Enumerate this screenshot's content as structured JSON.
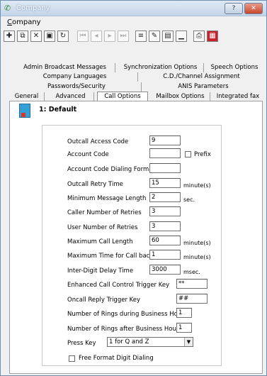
{
  "window": {
    "title": "Company",
    "help_label": "?",
    "close_label": "✕"
  },
  "menu": {
    "company": "Company"
  },
  "toolbar": {
    "buttons": [
      {
        "name": "add-icon",
        "glyph": "✚"
      },
      {
        "name": "copy-icon",
        "glyph": "⧉"
      },
      {
        "name": "delete-icon",
        "glyph": "✕"
      },
      {
        "name": "save-icon",
        "glyph": "▣"
      },
      {
        "name": "refresh-icon",
        "glyph": "↻"
      },
      {
        "name": "first-record-icon",
        "glyph": "⏮"
      },
      {
        "name": "previous-record-icon",
        "glyph": "◂"
      },
      {
        "name": "next-record-icon",
        "glyph": "▸"
      },
      {
        "name": "last-record-icon",
        "glyph": "⏭"
      },
      {
        "name": "list-icon",
        "glyph": "≡"
      },
      {
        "name": "edit-icon",
        "glyph": "✎"
      },
      {
        "name": "properties-icon",
        "glyph": "▤"
      },
      {
        "name": "chart-icon",
        "glyph": "▁"
      },
      {
        "name": "print-icon",
        "glyph": "⎙"
      },
      {
        "name": "report-icon",
        "glyph": "▦"
      }
    ]
  },
  "tabs": {
    "row1": [
      "Admin Broadcast Messages",
      "Synchronization Options",
      "Speech Options"
    ],
    "row2": [
      "Company Languages",
      "C.D./Channel Assignment"
    ],
    "row3": [
      "Passwords/Security",
      "ANIS Parameters"
    ],
    "row4": [
      "General",
      "Advanced",
      "Call Options",
      "Mailbox Options",
      "Integrated fax"
    ]
  },
  "header": {
    "text": "1: Default"
  },
  "form": {
    "outcall_access_code": {
      "label": "Outcall Access Code",
      "value": "9"
    },
    "account_code": {
      "label": "Account Code",
      "value": "",
      "prefix_label": "Prefix"
    },
    "account_code_dialing_format": {
      "label": "Account Code Dialing Format",
      "value": ""
    },
    "outcall_retry_time": {
      "label": "Outcall Retry Time",
      "value": "15",
      "unit": "minute(s)"
    },
    "minimum_message_length": {
      "label": "Minimum Message Length",
      "value": "2",
      "unit": "sec."
    },
    "caller_number_of_retries": {
      "label": "Caller Number of Retries",
      "value": "3"
    },
    "user_number_of_retries": {
      "label": "User Number of Retries",
      "value": "3"
    },
    "maximum_call_length": {
      "label": "Maximum Call Length",
      "value": "60",
      "unit": "minute(s)"
    },
    "maximum_time_for_call_back": {
      "label": "Maximum Time for Call back",
      "value": "1",
      "unit": "minute(s)"
    },
    "inter_digit_delay_time": {
      "label": "Inter-Digit Delay Time",
      "value": "3000",
      "unit": "msec."
    },
    "enhanced_call_control_trigger_key": {
      "label": "Enhanced Call Control Trigger Key",
      "value": "**"
    },
    "oncall_reply_trigger_key": {
      "label": "Oncall Reply Trigger Key",
      "value": "##"
    },
    "rings_during_business_hours": {
      "label": "Number of Rings during Business Hours",
      "value": "1"
    },
    "rings_after_business_hours": {
      "label": "Number of Rings after Business Hours",
      "value": "1"
    },
    "press_key": {
      "label": "Press Key",
      "value": "1 for Q and Z"
    },
    "free_format_digit_dialing": {
      "label": "Free Format Digit Dialing"
    }
  }
}
